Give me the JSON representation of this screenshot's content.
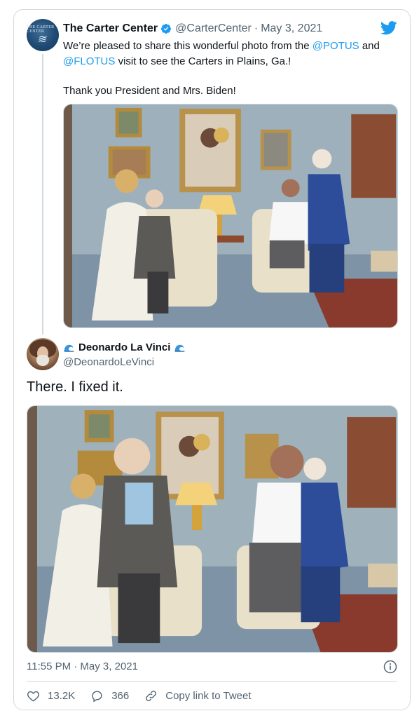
{
  "reply_to": {
    "name": "The Carter Center",
    "handle": "@CarterCenter",
    "date": "May 3, 2021",
    "text_before_1": "We’re pleased to share this wonderful photo from the ",
    "mention_1": "@POTUS",
    "text_between": " and ",
    "mention_2": "@FLOTUS",
    "text_after": " visit to see the Carters in Plains, Ga.!",
    "text_line_2": "Thank you President and Mrs. Biden!",
    "avatar_label": "THE CARTER CENTER",
    "photo_alt": "Photo of the Bidens visiting the Carters in their living room"
  },
  "tweet": {
    "name": "Deonardo La Vinci",
    "handle": "@DeonardoLeVinci",
    "text": "There. I fixed it.",
    "photo_alt": "Edited version of the photo with the Carters enlarged",
    "timestamp": "11:55 PM · May 3, 2021"
  },
  "actions": {
    "likes": "13.2K",
    "replies": "366",
    "copy_link": "Copy link to Tweet"
  },
  "colors": {
    "accent": "#1d9bf0",
    "text": "#0f1419",
    "muted": "#536471",
    "border": "#cfd9de"
  },
  "icons": [
    "verified-badge-icon",
    "twitter-bird-icon",
    "wave-emoji-icon",
    "info-icon",
    "heart-icon",
    "reply-bubble-icon",
    "link-icon"
  ]
}
